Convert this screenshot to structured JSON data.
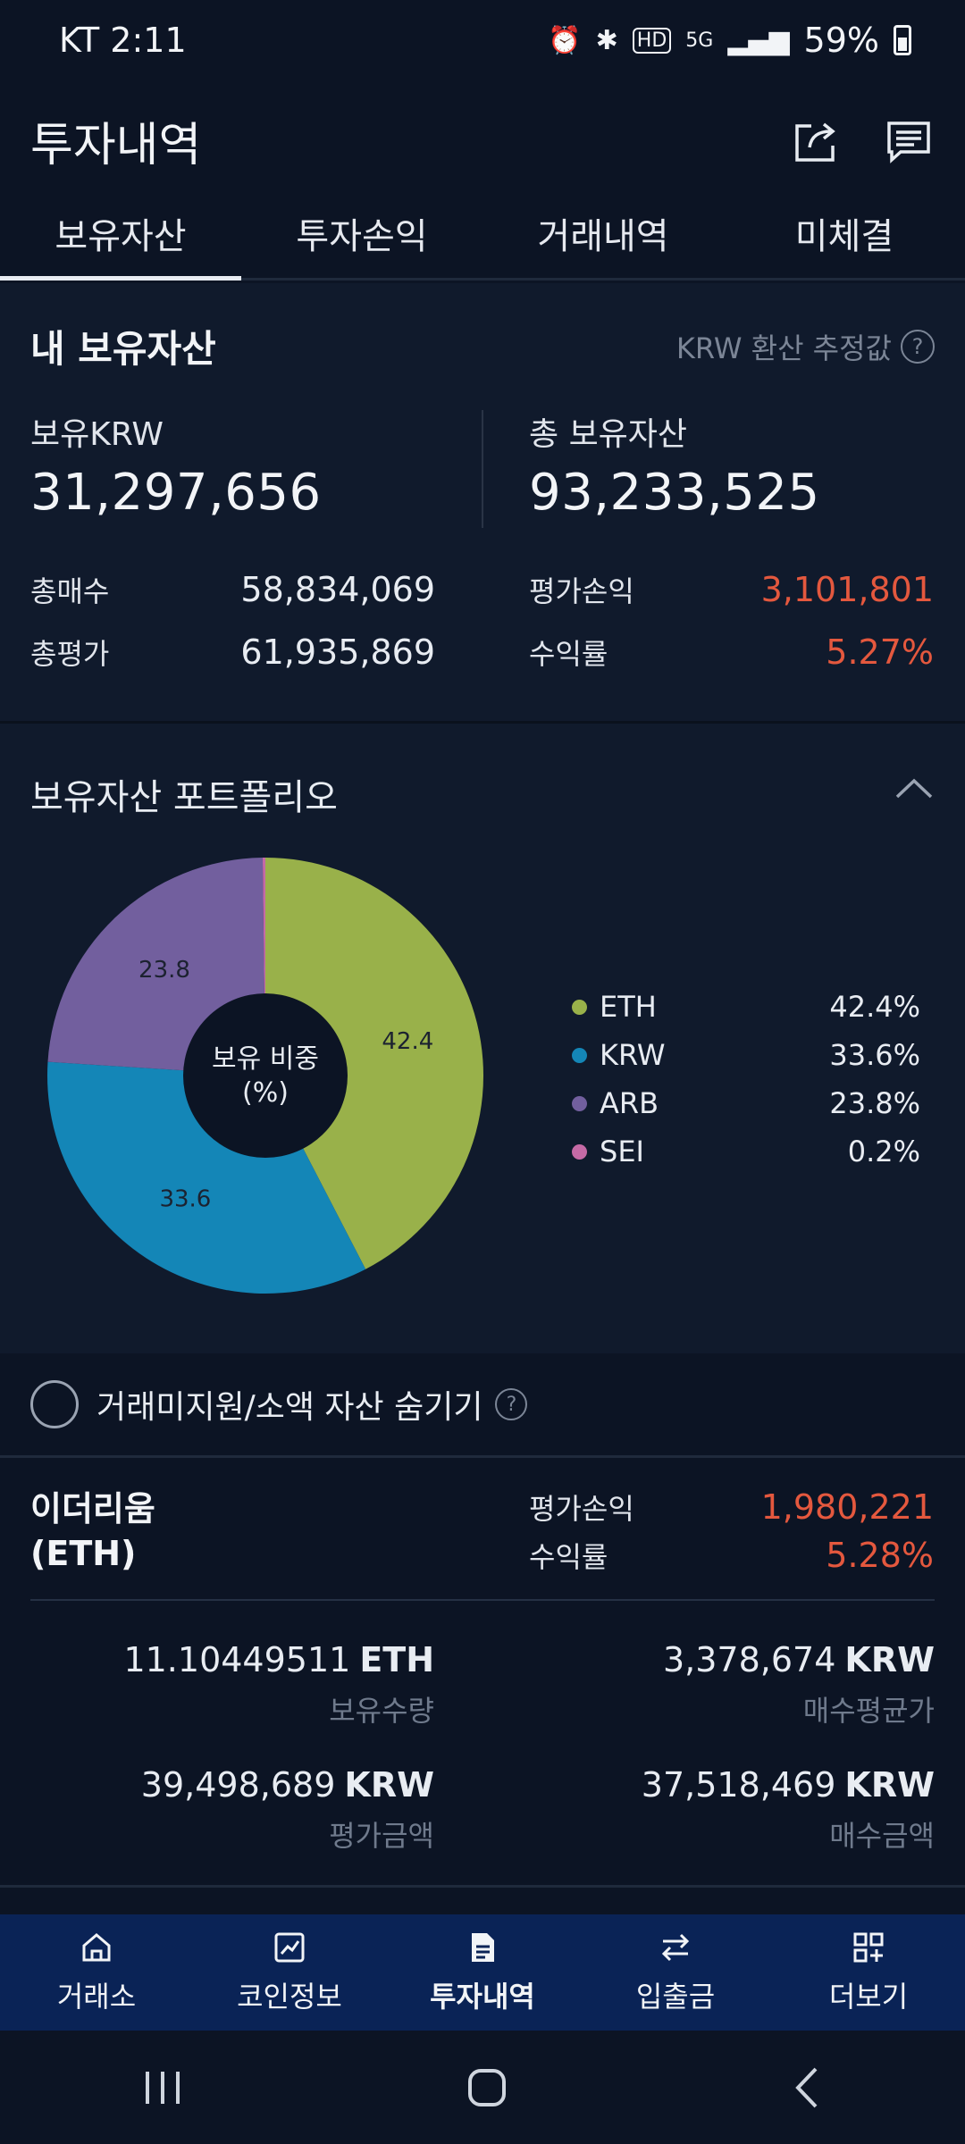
{
  "status": {
    "carrier": "KT",
    "time": "2:11",
    "battery": "59%"
  },
  "header": {
    "title": "투자내역"
  },
  "tabs": [
    {
      "label": "보유자산",
      "active": true
    },
    {
      "label": "투자손익"
    },
    {
      "label": "거래내역"
    },
    {
      "label": "미체결"
    }
  ],
  "assets": {
    "title": "내 보유자산",
    "note": "KRW 환산 추정값",
    "krw_label": "보유KRW",
    "krw_value": "31,297,656",
    "total_label": "총 보유자산",
    "total_value": "93,233,525",
    "buy_label": "총매수",
    "buy_value": "58,834,069",
    "eval_label": "총평가",
    "eval_value": "61,935,869",
    "pl_label": "평가손익",
    "pl_value": "3,101,801",
    "rate_label": "수익률",
    "rate_value": "5.27%"
  },
  "portfolio": {
    "title": "보유자산 포트폴리오",
    "center_line1": "보유 비중",
    "center_line2": "(%)",
    "legend": [
      {
        "name": "ETH",
        "pct": "42.4%",
        "color": "#99b14a"
      },
      {
        "name": "KRW",
        "pct": "33.6%",
        "color": "#1486b7"
      },
      {
        "name": "ARB",
        "pct": "23.8%",
        "color": "#725f9e"
      },
      {
        "name": "SEI",
        "pct": "0.2%",
        "color": "#c56aa6"
      }
    ]
  },
  "chart_data": {
    "type": "pie",
    "categories": [
      "ETH",
      "KRW",
      "ARB",
      "SEI"
    ],
    "values": [
      42.4,
      33.6,
      23.8,
      0.2
    ],
    "labels": [
      "42.4",
      "33.6",
      "23.8",
      ""
    ]
  },
  "filter": {
    "hide_label": "거래미지원/소액 자산 숨기기"
  },
  "holding": {
    "name_line1": "이더리움",
    "name_line2": "(ETH)",
    "pl_label": "평가손익",
    "pl_value": "1,980,221",
    "rate_label": "수익률",
    "rate_value": "5.28%",
    "qty_value": "11.10449511",
    "qty_unit": "ETH",
    "qty_label": "보유수량",
    "avg_value": "3,378,674",
    "avg_unit": "KRW",
    "avg_label": "매수평균가",
    "eval_value": "39,498,689",
    "eval_unit": "KRW",
    "eval_label": "평가금액",
    "buy_value": "37,518,469",
    "buy_unit": "KRW",
    "buy_label": "매수금액"
  },
  "nav": [
    {
      "label": "거래소"
    },
    {
      "label": "코인정보"
    },
    {
      "label": "투자내역",
      "active": true
    },
    {
      "label": "입출금"
    },
    {
      "label": "더보기"
    }
  ],
  "colors": {
    "red": "#e4583e",
    "nav_bg": "#0a2356",
    "bg": "#0c1424"
  }
}
